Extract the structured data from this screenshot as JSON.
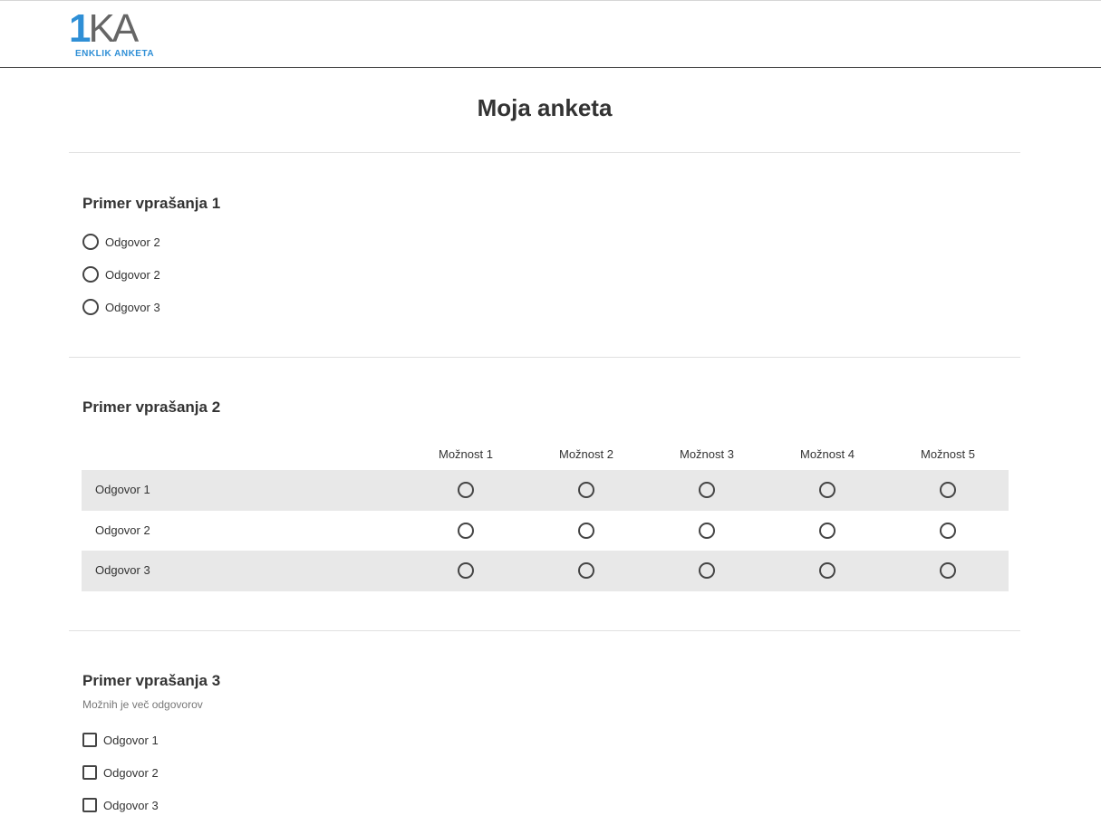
{
  "header": {
    "logo_mark_one": "1",
    "logo_mark_rest": "KA",
    "logo_sub": "ENKLIK ANKETA"
  },
  "survey": {
    "title": "Moja anketa"
  },
  "q1": {
    "title": "Primer vprašanja 1",
    "options": [
      "Odgovor 2",
      "Odgovor 2",
      "Odgovor 3"
    ]
  },
  "q2": {
    "title": "Primer vprašanja 2",
    "columns": [
      "Možnost 1",
      "Možnost 2",
      "Možnost 3",
      "Možnost 4",
      "Možnost 5"
    ],
    "rows": [
      "Odgovor 1",
      "Odgovor 2",
      "Odgovor 3"
    ]
  },
  "q3": {
    "title": "Primer vprašanja 3",
    "note": "Možnih je več odgovorov",
    "options": [
      "Odgovor 1",
      "Odgovor 2",
      "Odgovor 3"
    ]
  }
}
